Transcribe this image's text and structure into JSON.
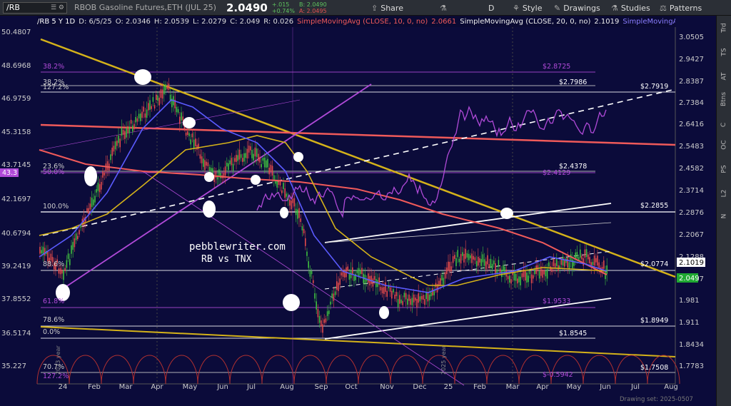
{
  "toolbar": {
    "symbol": "/RB",
    "symbol_icons": "☰ ⚙",
    "instrument": "RBOB Gasoline Futures,ETH (JUL 25)",
    "last": "2.0490",
    "change_abs": "+.015",
    "change_pct": "+0.74%",
    "bid": "B: 2.0490",
    "ask": "A: 2.0495",
    "share": "Share",
    "period": "D",
    "style": "Style",
    "drawings": "Drawings",
    "studies": "Studies",
    "patterns": "Patterns"
  },
  "infobar": {
    "chart": "/RB 5 Y 1D",
    "date": "D: 6/5/25",
    "open": "O: 2.0346",
    "high": "H: 2.0539",
    "low": "L: 2.0279",
    "close": "C: 2.049",
    "range": "R: 0.026",
    "sma1": "SimpleMovingAvg (CLOSE, 10, 0, no)",
    "sma1_val": "2.0661",
    "sma2": "SimpleMovingAvg (CLOSE, 20, 0, no)",
    "sma2_val": "2.1019",
    "sma3": "SimpleMovingAvg (CLOSE, 2"
  },
  "right_tabs": [
    "Trd",
    "TS",
    "AT",
    "Btns",
    "C",
    "OC",
    "PS",
    "L2",
    "N"
  ],
  "left_axis": [
    "50.4807",
    "48.6968",
    "46.9759",
    "45.3158",
    "43.7145",
    "42.1697",
    "40.6794",
    "39.2419",
    "37.8552",
    "36.5174",
    "35.227"
  ],
  "right_axis": [
    "3.0505",
    "2.9427",
    "2.8387",
    "2.7384",
    "2.6416",
    "2.5483",
    "2.4582",
    "2.3714",
    "2.2876",
    "2.2067",
    "2.1288",
    "2.0537",
    "1.981",
    "1.911",
    "1.8434",
    "1.7783"
  ],
  "x_axis": [
    "24",
    "Feb",
    "Mar",
    "Apr",
    "May",
    "Jun",
    "Jul",
    "Aug",
    "Sep",
    "Oct",
    "Nov",
    "Dec",
    "25",
    "Feb",
    "Mar",
    "Apr",
    "May",
    "Jun",
    "Jul",
    "Aug"
  ],
  "fib_labels": [
    "38.2%",
    "38.2%",
    "127.2%",
    "23.6%",
    "50.0%",
    "100.0%",
    "88.6%",
    "61.8%",
    "78.6%",
    "0.0%",
    "70.7%",
    "127.2%"
  ],
  "price_labels": [
    "$2.8725",
    "$2.7986",
    "$2.7919",
    "$2.4378",
    "$2.4129",
    "$2.2855",
    "$2.0774",
    "$1.9533",
    "$1.8949",
    "$1.8545",
    "$1.7508",
    "$-0.5942"
  ],
  "markers": {
    "left_price": "43.3",
    "price_2_1019": "2.1019",
    "price_2_049": "2.049"
  },
  "watermark": {
    "site": "pebblewriter.com",
    "subtitle": "RB vs TNX"
  },
  "year_labels": [
    "2023 year",
    "2025 year"
  ],
  "footer_note": "Drawing set: 2025-0507",
  "colors": {
    "bg": "#0b0b3a",
    "gold": "#d4b21a",
    "red": "#f05a5a",
    "purple": "#b04ad8",
    "blue": "#5b5bff",
    "white": "#ffffff",
    "green_last": "#1fa832"
  }
}
